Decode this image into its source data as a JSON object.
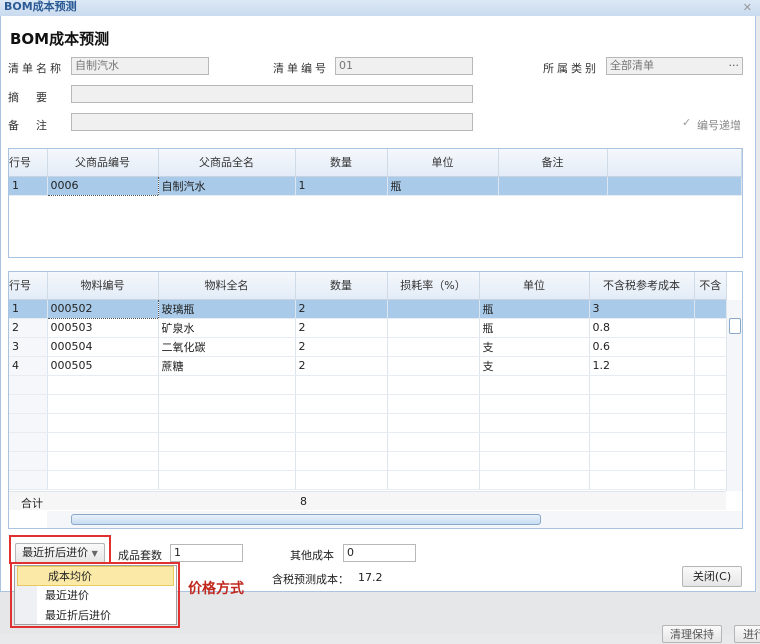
{
  "window": {
    "title": "BOM成本预测",
    "close": "✕"
  },
  "heading": "BOM成本预测",
  "form": {
    "list_name_label": "清单名称",
    "list_name_value": "自制汽水",
    "list_no_label": "清单编号",
    "list_no_value": "01",
    "category_label": "所属类别",
    "category_value": "全部清单",
    "category_btn": "···",
    "summary_label": "摘　要",
    "summary_value": "",
    "remark_label": "备　注",
    "remark_value": "",
    "auto_increment_label": "编号递增",
    "auto_increment_checked": true
  },
  "parent_grid": {
    "columns": [
      "行号",
      "父商品编号",
      "父商品全名",
      "数量",
      "单位",
      "备注",
      ""
    ],
    "rows": [
      [
        "1",
        "0006",
        "自制汽水",
        "1",
        "瓶",
        "",
        ""
      ]
    ]
  },
  "material_grid": {
    "columns": [
      "行号",
      "物料编号",
      "物料全名",
      "数量",
      "损耗率（%）",
      "单位",
      "不含税参考成本",
      "不含"
    ],
    "rows": [
      [
        "1",
        "000502",
        "玻璃瓶",
        "2",
        "",
        "瓶",
        "3",
        ""
      ],
      [
        "2",
        "000503",
        "矿泉水",
        "2",
        "",
        "瓶",
        "0.8",
        ""
      ],
      [
        "3",
        "000504",
        "二氧化碳",
        "2",
        "",
        "支",
        "0.6",
        ""
      ],
      [
        "4",
        "000505",
        "蔗糖",
        "2",
        "",
        "支",
        "1.2",
        ""
      ]
    ],
    "total_label": "合计",
    "total_qty": "8"
  },
  "bottom": {
    "price_method": "最近折后进价",
    "price_options": [
      "成本均价",
      "最近进价",
      "最近折后进价"
    ],
    "sets_label": "成品套数",
    "sets_value": "1",
    "other_cost_label": "其他成本",
    "other_cost_value": "0",
    "forecast_label": "含税预测成本：",
    "forecast_value": "17.2",
    "close_btn": "关闭(C)",
    "annotation": "价格方式"
  },
  "background_buttons": [
    "清理保持",
    "进行"
  ]
}
